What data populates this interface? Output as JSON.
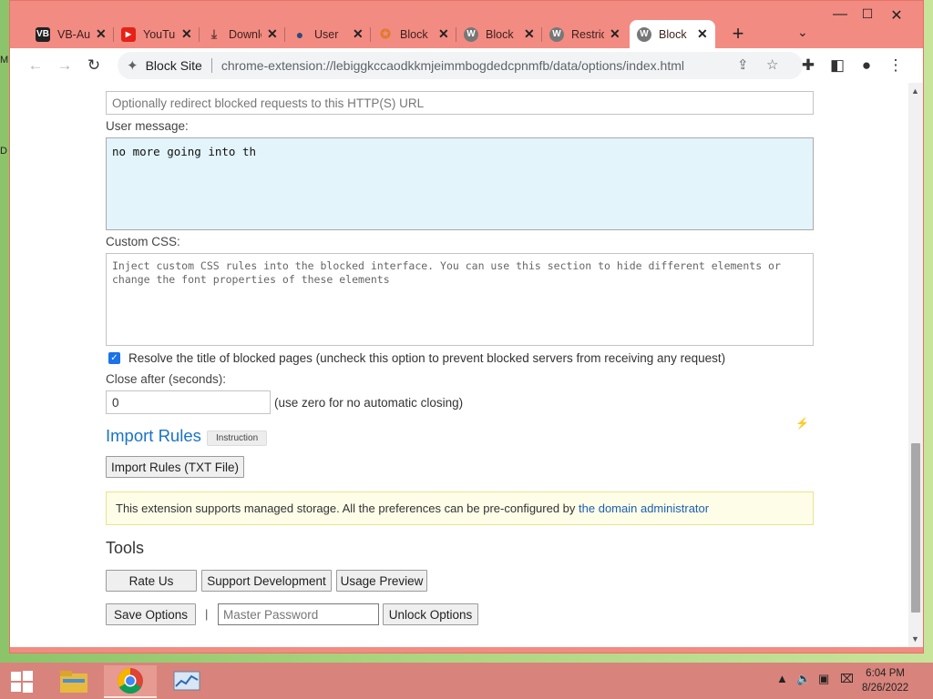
{
  "desktop": {
    "edge_glyphs": [
      "M",
      "D"
    ]
  },
  "tabs": [
    {
      "title": "VB-Audio",
      "favicon": "vb-logo-icon",
      "fav_text": "VB",
      "fav_color": "#222222"
    },
    {
      "title": "YouTube",
      "favicon": "youtube-icon",
      "fav_text": "▶",
      "fav_color": "#e62117"
    },
    {
      "title": "Downloads",
      "favicon": "download-icon",
      "fav_text": "⤓",
      "fav_color": "#6b3d38"
    },
    {
      "title": "User",
      "favicon": "user-icon",
      "fav_text": "●",
      "fav_color": "#2d4a7a"
    },
    {
      "title": "Block",
      "favicon": "block-site-icon",
      "fav_text": "✪",
      "fav_color": "#e07a2f"
    },
    {
      "title": "Block",
      "favicon": "w-logo-icon",
      "fav_text": "W",
      "fav_color": "#777777"
    },
    {
      "title": "Restrict",
      "favicon": "w-logo-icon",
      "fav_text": "W",
      "fav_color": "#777777"
    },
    {
      "title": "Block",
      "favicon": "w-logo-icon",
      "fav_text": "W",
      "fav_color": "#777777"
    }
  ],
  "toolbar": {
    "back": "←",
    "forward": "→",
    "reload": "↻",
    "site_name": "Block Site",
    "url": "chrome-extension://lebiggkccaodkkmjeimmbogdedcpnmfb/data/options/index.html"
  },
  "form": {
    "redirect_placeholder": "Optionally redirect blocked requests to this HTTP(S) URL",
    "user_message_label": "User message:",
    "user_message_value": "no more going into th",
    "custom_css_label": "Custom CSS:",
    "custom_css_placeholder": "Inject custom CSS rules into the blocked interface. You can use this section to hide different elements or change the font properties of these elements",
    "resolve_title_label": "Resolve the title of blocked pages (uncheck this option to prevent blocked servers from receiving any request)",
    "resolve_title_checked": true,
    "close_after_label": "Close after (seconds):",
    "close_after_value": "0",
    "close_after_hint": "(use zero for no automatic closing)"
  },
  "import": {
    "title": "Import Rules",
    "badge": "Instruction",
    "button": "Import Rules (TXT File)"
  },
  "managed": {
    "text": "This extension supports managed storage. All the preferences can be pre-configured by ",
    "link": "the domain administrator"
  },
  "tools": {
    "title": "Tools",
    "rate": "Rate Us",
    "support": "Support Development",
    "preview": "Usage Preview",
    "save": "Save Options",
    "separator": "|",
    "master_password_placeholder": "Master Password",
    "unlock": "Unlock Options"
  },
  "taskbar": {
    "time": "6:04 PM",
    "date": "8/26/2022"
  }
}
